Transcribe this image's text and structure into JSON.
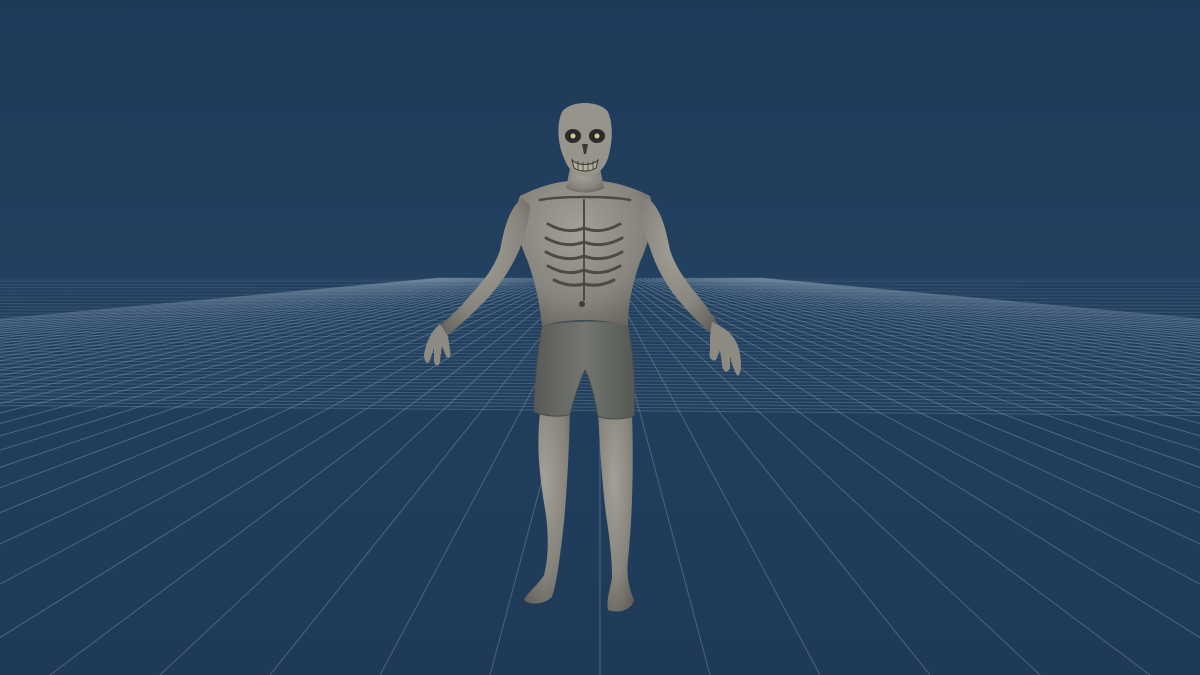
{
  "viewport": {
    "background_color": "#1f3a59",
    "top_border_color": "#3c3f43",
    "grid_color": "#8ea3b8",
    "horizon_color": "#2b4866"
  },
  "model": {
    "icon": "skeleton-zombie-model",
    "skin_color": "#8a8780",
    "skin_shadow_color": "#5f5c57",
    "shorts_color": "#6b6e6a",
    "eye_glow_color": "#d8c79a"
  }
}
